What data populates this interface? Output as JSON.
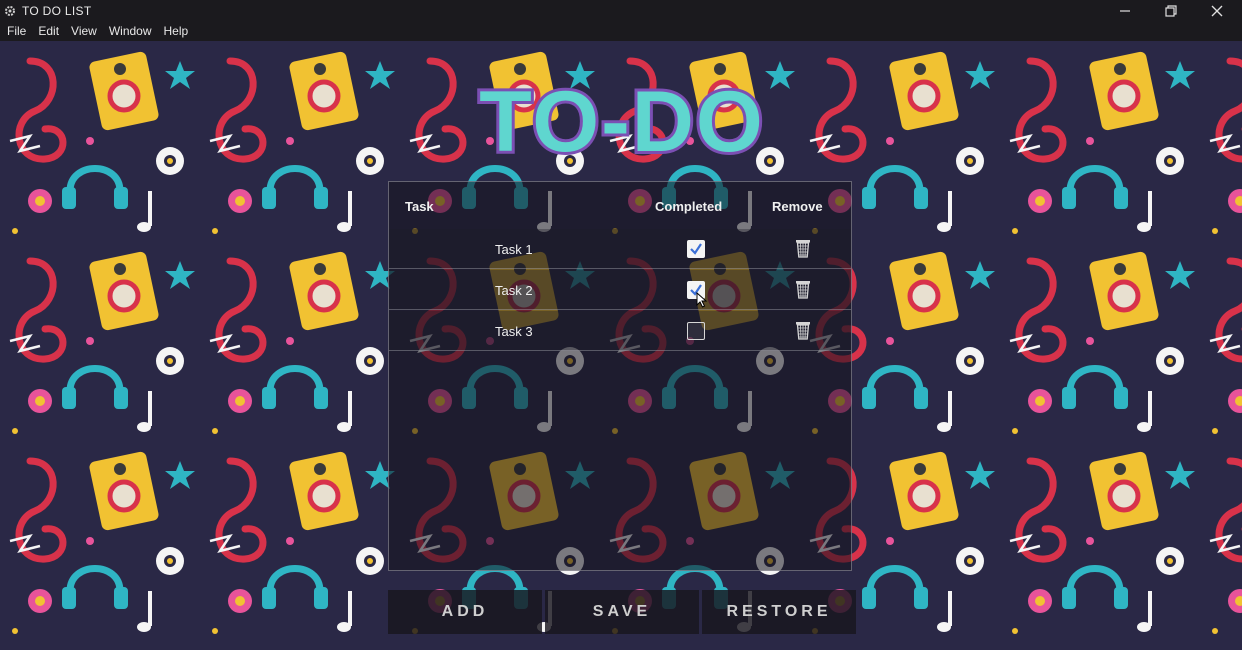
{
  "window": {
    "title": "TO DO LIST"
  },
  "menu": [
    "File",
    "Edit",
    "View",
    "Window",
    "Help"
  ],
  "app": {
    "logo_text": "TO-DO",
    "columns": {
      "task": "Task",
      "completed": "Completed",
      "remove": "Remove"
    },
    "tasks": [
      {
        "label": "Task 1",
        "completed": true
      },
      {
        "label": "Task 2",
        "completed": true
      },
      {
        "label": "Task 3",
        "completed": false
      }
    ],
    "buttons": {
      "add": "ADD",
      "save": "SAVE",
      "restore": "RESTORE"
    }
  },
  "colors": {
    "logo_fill": "#5fd6cf",
    "logo_outline": "#7b4fb3",
    "background": "#2a2846",
    "titlebar": "#1b1a1e"
  },
  "icons": [
    "app-gear-icon",
    "minimize-icon",
    "restore-window-icon",
    "close-icon",
    "checkbox-icon",
    "trash-icon",
    "mouse-cursor-icon"
  ]
}
